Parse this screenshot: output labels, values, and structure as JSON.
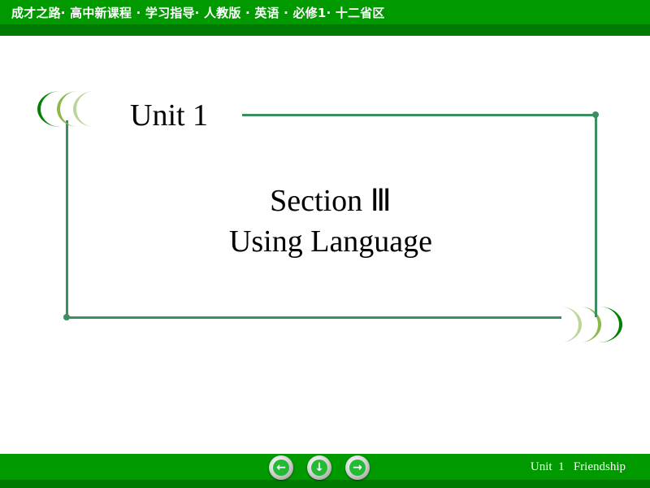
{
  "header": {
    "title": "成才之路· 高中新课程 · 学习指导· 人教版 · 英语 · 必修1· 十二省区"
  },
  "slide": {
    "unit_label": "Unit 1",
    "section_label": "Section Ⅲ",
    "subtitle": "Using Language"
  },
  "footer": {
    "text": "Unit  1   Friendship",
    "nav": {
      "prev_icon": "arrow-left-icon",
      "home_icon": "arrow-down-icon",
      "next_icon": "arrow-right-icon",
      "prev_glyph": "←",
      "down_glyph": "↓",
      "next_glyph": "→"
    }
  },
  "colors": {
    "bar_green": "#009900",
    "bar_stripe": "#007a00",
    "frame_green": "#3a8f62",
    "crescent_dark": "#008000",
    "crescent_mid": "#8db84a",
    "crescent_light": "#bcd69a"
  }
}
